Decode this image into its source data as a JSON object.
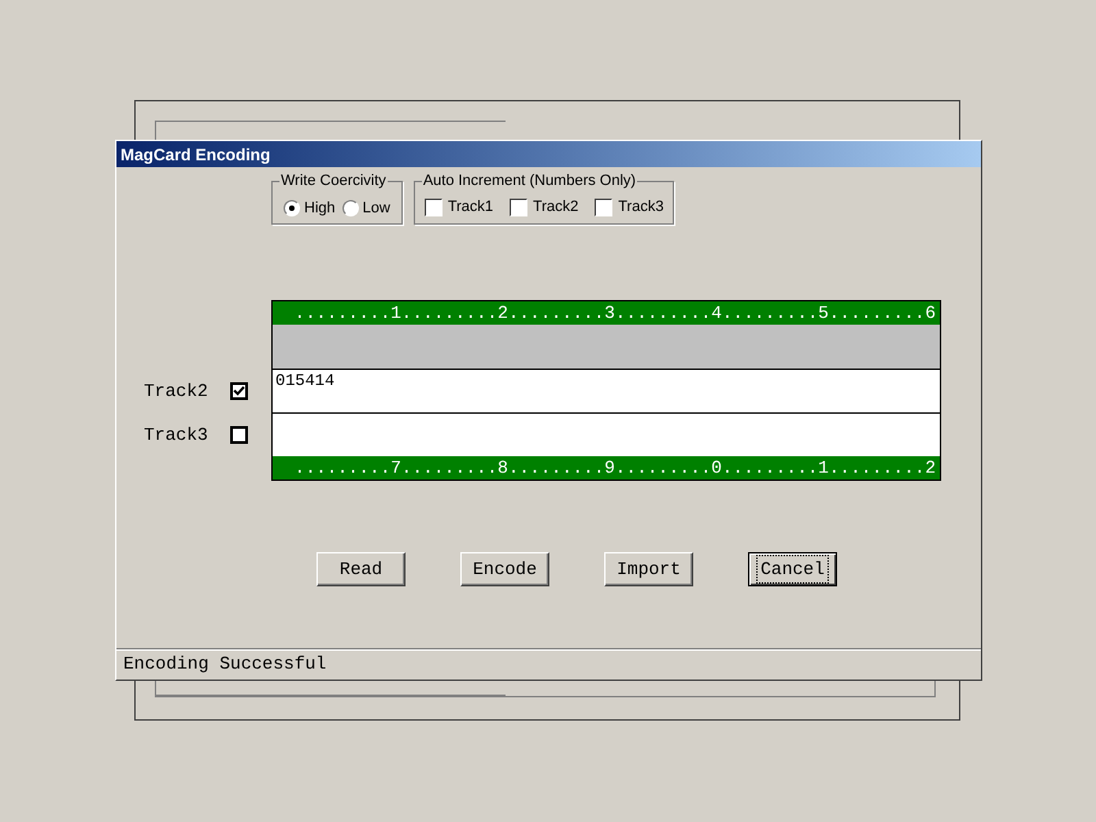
{
  "window": {
    "title": "MagCard Encoding"
  },
  "write_coercivity": {
    "label": "Write Coercivity",
    "options": [
      {
        "label": "High",
        "selected": true
      },
      {
        "label": "Low",
        "selected": false
      }
    ]
  },
  "auto_increment": {
    "label": "Auto Increment (Numbers Only)",
    "options": [
      {
        "label": "Track1",
        "checked": false
      },
      {
        "label": "Track2",
        "checked": false
      },
      {
        "label": "Track3",
        "checked": false
      }
    ]
  },
  "ruler_top": ".........1.........2.........3.........4.........5.........6",
  "tracks": [
    {
      "enabled": false
    },
    {
      "enabled": true,
      "label": "Track2",
      "checked": true,
      "value": "015414"
    },
    {
      "enabled": true,
      "label": "Track3",
      "checked": false
    }
  ],
  "ruler_bottom": ".........7.........8.........9.........0.........1.........2",
  "buttons": [
    {
      "label": "Read",
      "focused": false
    },
    {
      "label": "Encode",
      "focused": false
    },
    {
      "label": "Import",
      "focused": false
    },
    {
      "label": "Cancel",
      "focused": true
    }
  ],
  "status_bar": "Encoding Successful"
}
